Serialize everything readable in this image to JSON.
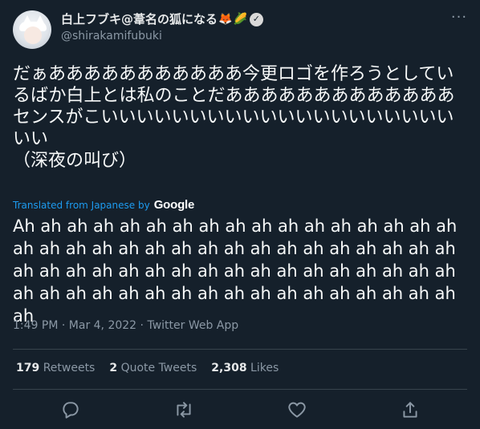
{
  "author": {
    "display_name": "白上フブキ@葦名の狐になる",
    "emojis": [
      "🦊",
      "🌽"
    ],
    "handle": "@shirakamifubuki"
  },
  "tweet": {
    "text": "だぁあああああああああああ今更ロゴを作ろうとしているばか白上とは私のことだあああああああああああああ\nセンスがこいいいいいいいいいいいいいいいいいいいいいい\n（深夜の叫び）",
    "translated_label": "Translated from Japanese by",
    "translator": "Google",
    "translation": "Ah ah ah ah ah ah ah ah ah ah ah ah ah ah ah ah ah ah ah ah ah ah ah ah ah ah ah ah ah ah ah ah ah ah ah ah ah ah ah ah ah ah ah ah ah ah ah ah ah ah ah ah ah ah ah ah ah ah ah ah ah ah ah ah ah ah ah ah ah"
  },
  "meta": {
    "time": "1:49 PM",
    "date": "Mar 4, 2022",
    "source": "Twitter Web App",
    "separator": " · "
  },
  "stats": {
    "retweets": "179",
    "retweets_label": "Retweets",
    "quote_tweets": "2",
    "quote_tweets_label": "Quote Tweets",
    "likes": "2,308",
    "likes_label": "Likes"
  },
  "colors": {
    "background": "#15202b",
    "accent": "#1d9bf0",
    "muted": "#8b98a5",
    "divider": "#38444d"
  },
  "icons": [
    "more-icon",
    "verified-icon",
    "reply-icon",
    "retweet-icon",
    "like-icon",
    "share-icon"
  ]
}
